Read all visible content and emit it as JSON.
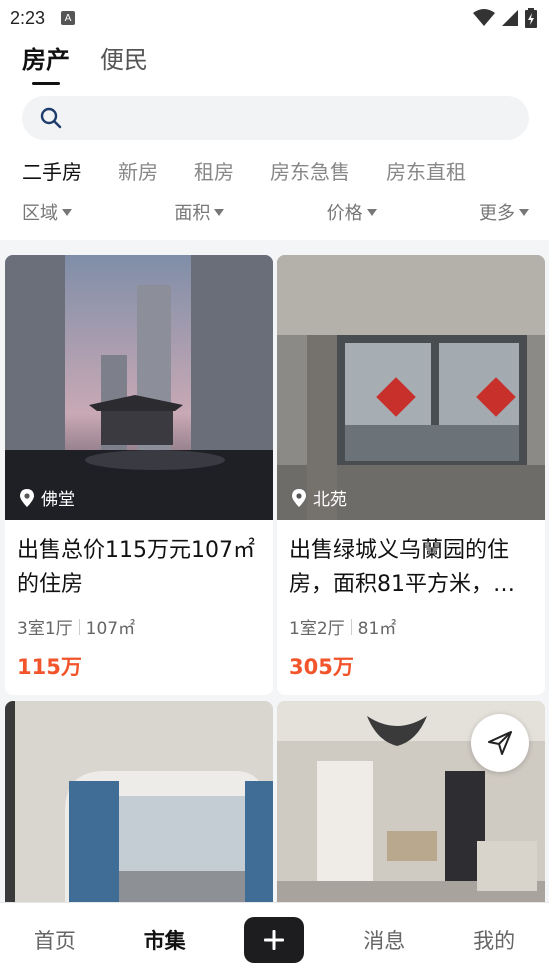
{
  "status_bar": {
    "time": "2:23",
    "badge": "A"
  },
  "top_tabs": [
    {
      "label": "房产",
      "active": true
    },
    {
      "label": "便民",
      "active": false
    }
  ],
  "search": {
    "placeholder": ""
  },
  "category_tabs": [
    {
      "label": "二手房",
      "active": true
    },
    {
      "label": "新房",
      "active": false
    },
    {
      "label": "租房",
      "active": false
    },
    {
      "label": "房东急售",
      "active": false
    },
    {
      "label": "房东直租",
      "active": false
    }
  ],
  "filters": [
    {
      "label": "区域"
    },
    {
      "label": "面积"
    },
    {
      "label": "价格"
    },
    {
      "label": "更多"
    }
  ],
  "listings": [
    {
      "location": "佛堂",
      "title": "出售总价115万元107㎡的住房",
      "rooms": "3室1厅",
      "area": "107㎡",
      "price": "115万"
    },
    {
      "location": "北苑",
      "title": "出售绿城义乌蘭园的住房，面积81平方米，…",
      "rooms": "1室2厅",
      "area": "81㎡",
      "price": "305万"
    }
  ],
  "bottom_nav": [
    {
      "label": "首页",
      "active": false
    },
    {
      "label": "市集",
      "active": true
    },
    {
      "label": "",
      "active": false
    },
    {
      "label": "消息",
      "active": false
    },
    {
      "label": "我的",
      "active": false
    }
  ],
  "colors": {
    "price": "#f2552c",
    "search_bg": "#f2f3f5",
    "plus_button": "#1d1d1f",
    "accent_icon": "#1d3b6b"
  }
}
